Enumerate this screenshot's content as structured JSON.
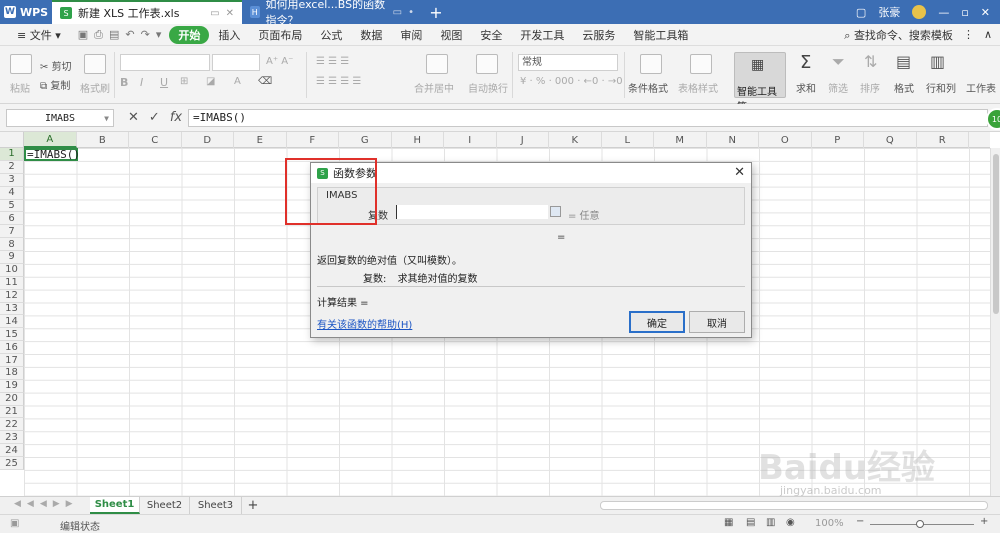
{
  "titlebar": {
    "app_name": "WPS",
    "tabs": [
      {
        "label": "新建 XLS 工作表.xls",
        "active": true
      },
      {
        "label": "如何用excel...BS的函数指令？",
        "active": false
      }
    ],
    "user": "张豪"
  },
  "menubar": {
    "file": "文件",
    "items": [
      "开始",
      "插入",
      "页面布局",
      "公式",
      "数据",
      "审阅",
      "视图",
      "安全",
      "开发工具",
      "云服务",
      "智能工具箱"
    ],
    "search": "查找命令、搜索模板"
  },
  "ribbon": {
    "paste": "粘贴",
    "cut": "剪切",
    "copy": "复制",
    "format_painter": "格式刷",
    "merge_center": "合并居中",
    "auto_wrap": "自动换行",
    "number_format": "常规",
    "conditional_format": "条件格式",
    "table_style": "表格样式",
    "smart_toolbox": "智能工具箱",
    "sum": "求和",
    "filter": "筛选",
    "sort": "排序",
    "format": "格式",
    "row_col": "行和列",
    "worksheet": "工作表"
  },
  "formula_bar": {
    "name_box": "IMABS",
    "formula": "=IMABS()"
  },
  "grid": {
    "columns": [
      "A",
      "B",
      "C",
      "D",
      "E",
      "F",
      "G",
      "H",
      "I",
      "J",
      "K",
      "L",
      "M",
      "N",
      "O",
      "P",
      "Q",
      "R"
    ],
    "rows": [
      "1",
      "2",
      "3",
      "4",
      "5",
      "6",
      "7",
      "8",
      "9",
      "10",
      "11",
      "12",
      "13",
      "14",
      "15",
      "16",
      "17",
      "18",
      "19",
      "20",
      "21",
      "22",
      "23",
      "24",
      "25"
    ],
    "active_cell_value": "=IMABS()"
  },
  "sheets": [
    "Sheet1",
    "Sheet2",
    "Sheet3"
  ],
  "status": {
    "mode": "编辑状态",
    "zoom": "100%"
  },
  "dialog": {
    "title": "函数参数",
    "function_name": "IMABS",
    "arg_label": "复数",
    "arg_eq": "= 任意",
    "result_eq": "=",
    "description": "返回复数的绝对值（又叫模数）。",
    "arg_desc_name": "复数:",
    "arg_desc_text": "求其绝对值的复数",
    "calc_result": "计算结果 =",
    "help_link": "有关该函数的帮助(H)",
    "ok": "确定",
    "cancel": "取消"
  },
  "badge": "10",
  "watermark": {
    "main": "Baidu经验",
    "sub": "jingyan.baidu.com"
  }
}
